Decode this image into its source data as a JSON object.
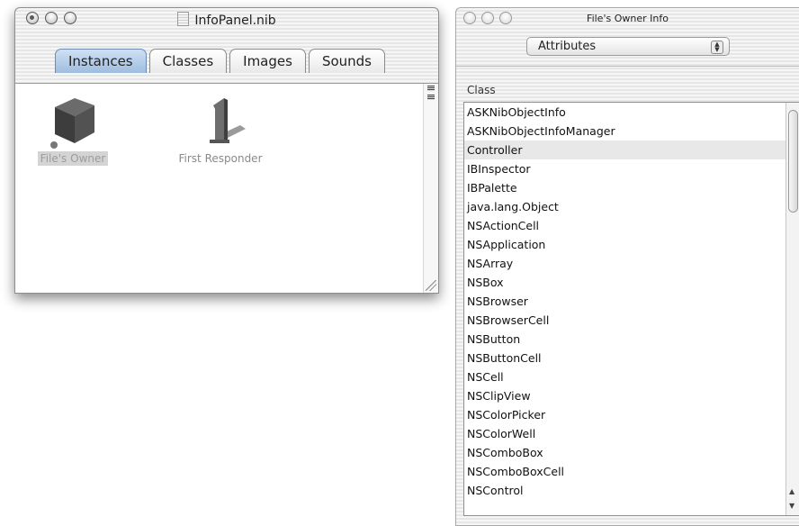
{
  "nib_window": {
    "title": "InfoPanel.nib",
    "tabs": [
      {
        "label": "Instances",
        "active": true
      },
      {
        "label": "Classes",
        "active": false
      },
      {
        "label": "Images",
        "active": false
      },
      {
        "label": "Sounds",
        "active": false
      }
    ],
    "instances": [
      {
        "label": "File's Owner",
        "icon": "cube-icon",
        "selected": true
      },
      {
        "label": "First Responder",
        "icon": "first-responder-icon",
        "selected": false
      }
    ]
  },
  "info_window": {
    "title": "File's Owner Info",
    "popup_value": "Attributes",
    "class_header": "Class",
    "classes": [
      "ASKNibObjectInfo",
      "ASKNibObjectInfoManager",
      "Controller",
      "IBInspector",
      "IBPalette",
      "java.lang.Object",
      "NSActionCell",
      "NSApplication",
      "NSArray",
      "NSBox",
      "NSBrowser",
      "NSBrowserCell",
      "NSButton",
      "NSButtonCell",
      "NSCell",
      "NSClipView",
      "NSColorPicker",
      "NSColorWell",
      "NSComboBox",
      "NSComboBoxCell",
      "NSControl"
    ],
    "selected_class": "Controller"
  },
  "colors": {
    "active_tab": "#9ebde0",
    "selection": "#e8e8e8"
  }
}
